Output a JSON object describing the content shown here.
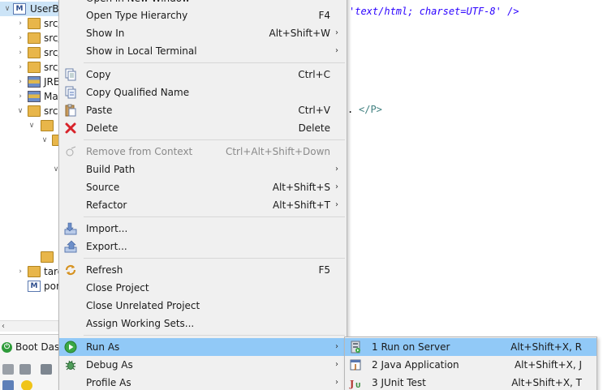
{
  "explorer": {
    "rows": [
      {
        "label": "UserBo",
        "twisty": "∨"
      },
      {
        "label": "src/",
        "twisty": "›"
      },
      {
        "label": "src/",
        "twisty": "›"
      },
      {
        "label": "src/",
        "twisty": "›"
      },
      {
        "label": "src/",
        "twisty": "›"
      },
      {
        "label": "JRE",
        "twisty": "›"
      },
      {
        "label": "Ma",
        "twisty": "›"
      },
      {
        "label": "src",
        "twisty": "∨"
      },
      {
        "label": "",
        "twisty": "∨"
      },
      {
        "label": "",
        "twisty": "∨"
      },
      {
        "label": "",
        "twisty": "∨"
      },
      {
        "label": "targ",
        "twisty": "›"
      },
      {
        "label": "pon",
        "twisty": ""
      }
    ]
  },
  "editor": {
    "line1": "'text/html; charset=UTF-8' />",
    "line2_dot": ".",
    "line2_tag": "</P>"
  },
  "boot_dashboard": {
    "tab_label": "Boot Dash"
  },
  "context_menu": {
    "partial_top": "Open in New Window",
    "items": {
      "open_type_hierarchy": {
        "label": "Open Type Hierarchy",
        "shortcut": "F4"
      },
      "show_in": {
        "label": "Show In",
        "shortcut": "Alt+Shift+W",
        "arrow": "›"
      },
      "show_in_terminal": {
        "label": "Show in Local Terminal",
        "arrow": "›"
      },
      "copy": {
        "label": "Copy",
        "shortcut": "Ctrl+C",
        "icon": "copy-icon"
      },
      "copy_qualified": {
        "label": "Copy Qualified Name",
        "icon": "copy-qualified-icon"
      },
      "paste": {
        "label": "Paste",
        "shortcut": "Ctrl+V",
        "icon": "paste-icon"
      },
      "delete": {
        "label": "Delete",
        "shortcut": "Delete",
        "icon": "delete-icon"
      },
      "remove_context": {
        "label": "Remove from Context",
        "shortcut": "Ctrl+Alt+Shift+Down",
        "icon": "remove-context-icon"
      },
      "build_path": {
        "label": "Build Path",
        "arrow": "›"
      },
      "source": {
        "label": "Source",
        "shortcut": "Alt+Shift+S",
        "arrow": "›"
      },
      "refactor": {
        "label": "Refactor",
        "shortcut": "Alt+Shift+T",
        "arrow": "›"
      },
      "import": {
        "label": "Import...",
        "icon": "import-icon"
      },
      "export": {
        "label": "Export...",
        "icon": "export-icon"
      },
      "refresh": {
        "label": "Refresh",
        "shortcut": "F5",
        "icon": "refresh-icon"
      },
      "close_project": {
        "label": "Close Project"
      },
      "close_unrelated": {
        "label": "Close Unrelated Project"
      },
      "assign_working_sets": {
        "label": "Assign Working Sets..."
      },
      "run_as": {
        "label": "Run As",
        "arrow": "›",
        "icon": "run-icon"
      },
      "debug_as": {
        "label": "Debug As",
        "arrow": "›",
        "icon": "debug-icon"
      },
      "profile_as": {
        "label": "Profile As",
        "arrow": "›"
      }
    }
  },
  "run_as_submenu": {
    "items": [
      {
        "label": "1 Run on Server",
        "shortcut": "Alt+Shift+X, R",
        "icon": "server-icon"
      },
      {
        "label": "2 Java Application",
        "shortcut": "Alt+Shift+X, J",
        "icon": "java-app-icon"
      },
      {
        "label": "3 JUnit Test",
        "shortcut": "Alt+Shift+X, T",
        "icon": "junit-icon"
      }
    ]
  },
  "colors": {
    "highlight": "#91c9f7",
    "menu_bg": "#f0f0f0",
    "selection": "#cce4f7"
  }
}
